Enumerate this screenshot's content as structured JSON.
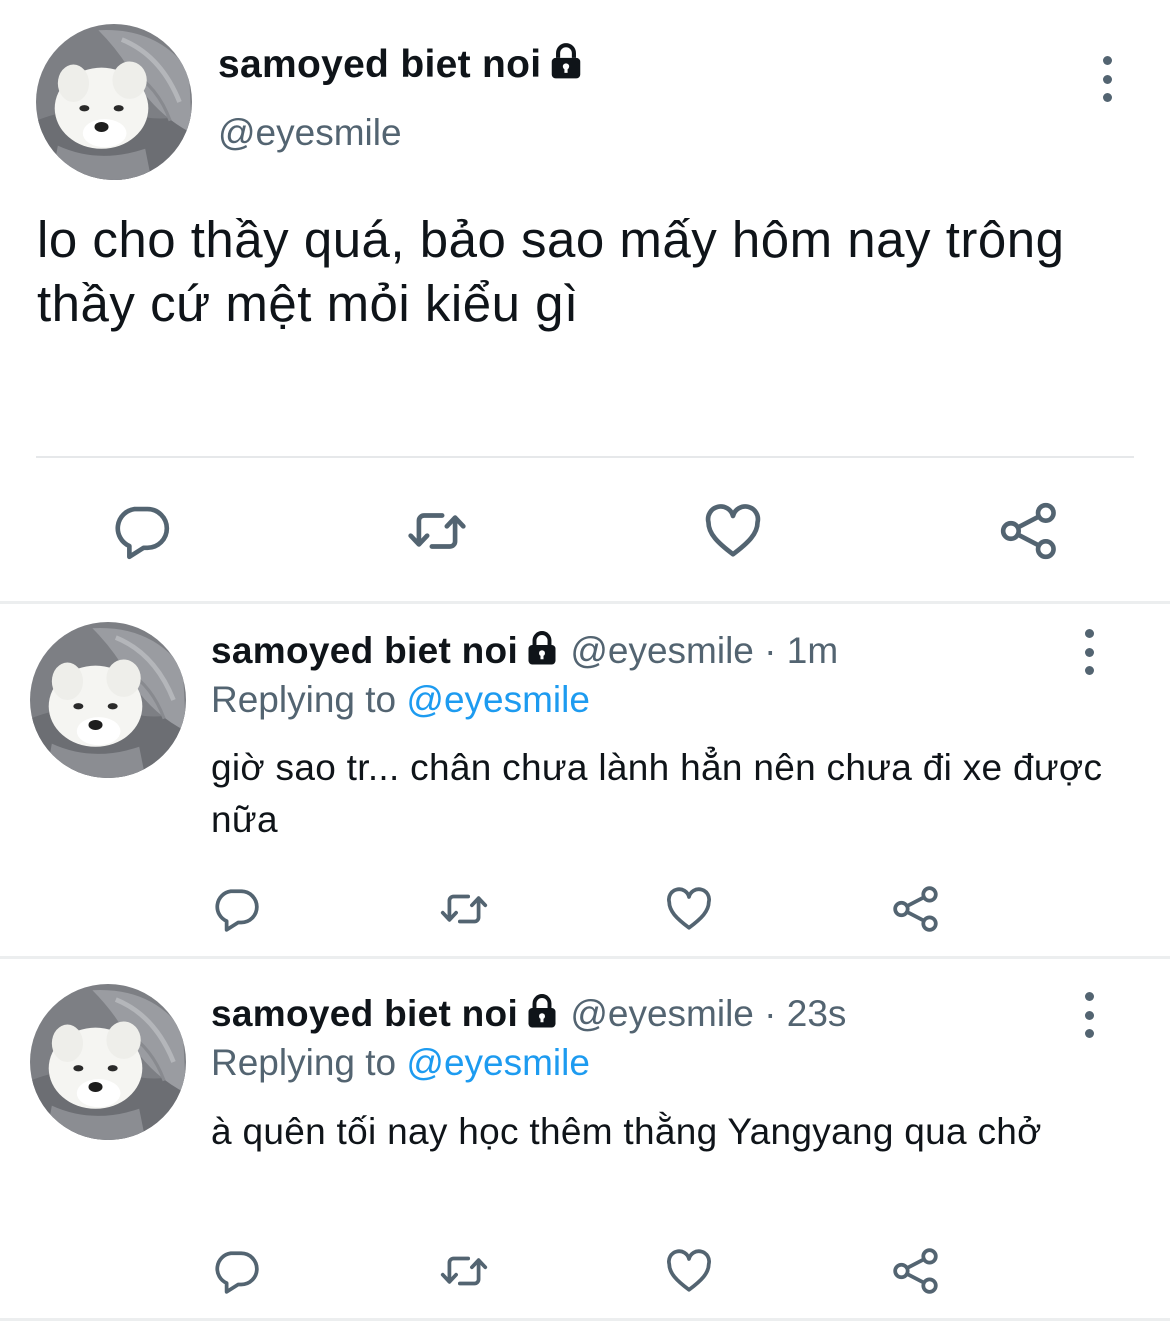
{
  "colors": {
    "text": "#0f1419",
    "secondary": "#536471",
    "accent": "#1d9bf0",
    "divider": "#eceeef"
  },
  "main_tweet": {
    "display_name": "samoyed biet noi",
    "handle": "@eyesmile",
    "text": "lo cho thầy quá, bảo sao mấy hôm nay trông thầy cứ mệt mỏi kiểu gì",
    "icons": [
      "reply-icon",
      "retweet-icon",
      "like-icon",
      "share-icon",
      "more-icon",
      "lock-icon"
    ]
  },
  "replies": [
    {
      "display_name": "samoyed biet noi",
      "handle": "@eyesmile",
      "time": "1m",
      "replying_label": "Replying to",
      "replying_handle": "@eyesmile",
      "text": "giờ sao tr... chân chưa lành hẳn nên chưa đi xe được nữa"
    },
    {
      "display_name": "samoyed biet noi",
      "handle": "@eyesmile",
      "time": "23s",
      "replying_label": "Replying to",
      "replying_handle": "@eyesmile",
      "text": "à quên tối nay học thêm thằng Yangyang qua chở"
    }
  ]
}
